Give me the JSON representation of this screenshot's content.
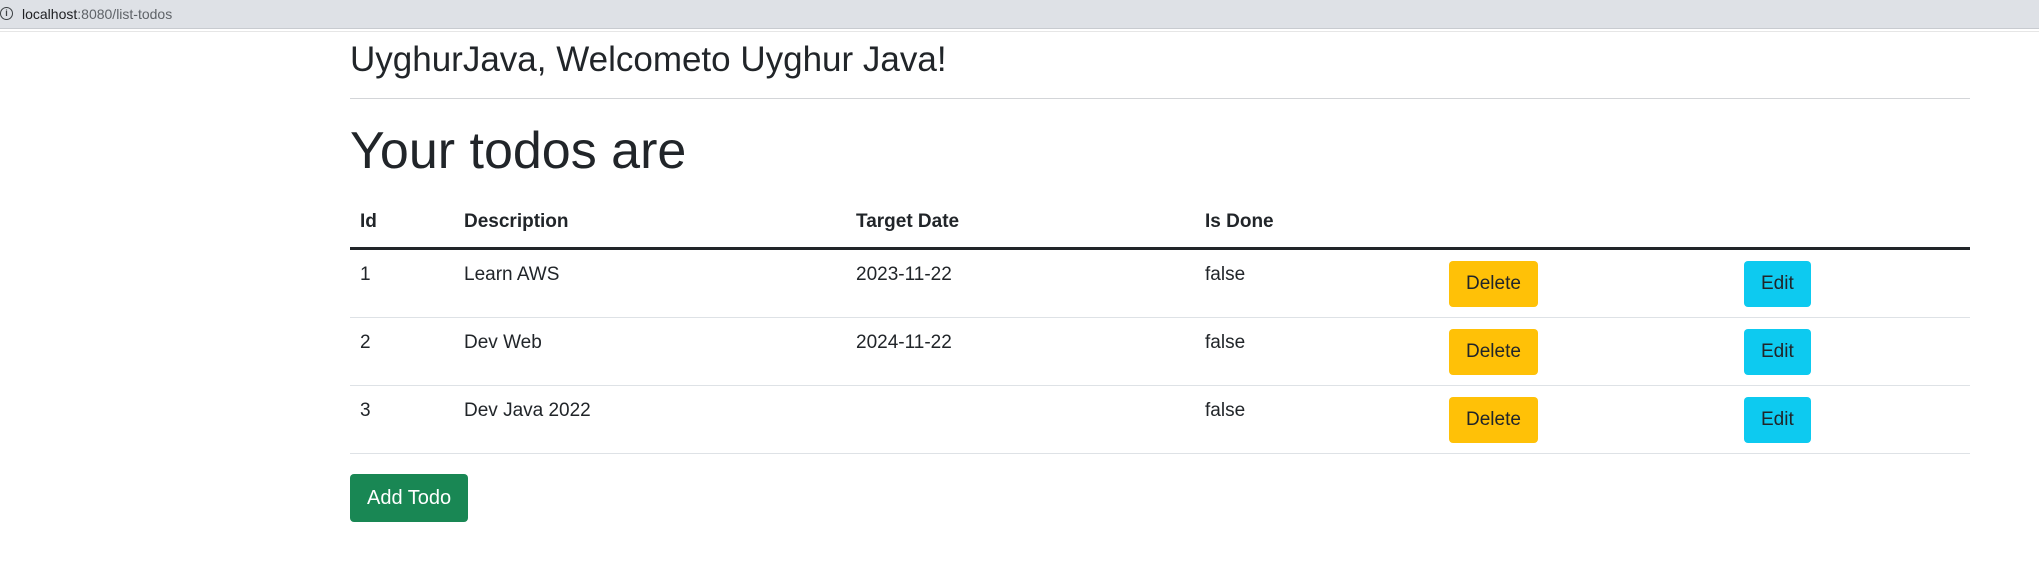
{
  "browser": {
    "url_host": "localhost",
    "url_path": ":8080/list-todos",
    "info_icon": "info-icon"
  },
  "page": {
    "welcome": "UyghurJava, Welcometo Uyghur Java!",
    "title": "Your todos are"
  },
  "table": {
    "headers": [
      "Id",
      "Description",
      "Target Date",
      "Is Done",
      "",
      ""
    ],
    "rows": [
      {
        "id": "1",
        "description": "Learn AWS",
        "target_date": "2023-11-22",
        "is_done": "false",
        "delete_label": "Delete",
        "edit_label": "Edit"
      },
      {
        "id": "2",
        "description": "Dev Web",
        "target_date": "2024-11-22",
        "is_done": "false",
        "delete_label": "Delete",
        "edit_label": "Edit"
      },
      {
        "id": "3",
        "description": "Dev Java 2022",
        "target_date": "",
        "is_done": "false",
        "delete_label": "Delete",
        "edit_label": "Edit"
      }
    ]
  },
  "actions": {
    "add_label": "Add Todo"
  },
  "colors": {
    "delete": "#ffc107",
    "edit": "#0dcaf0",
    "add": "#198754"
  }
}
